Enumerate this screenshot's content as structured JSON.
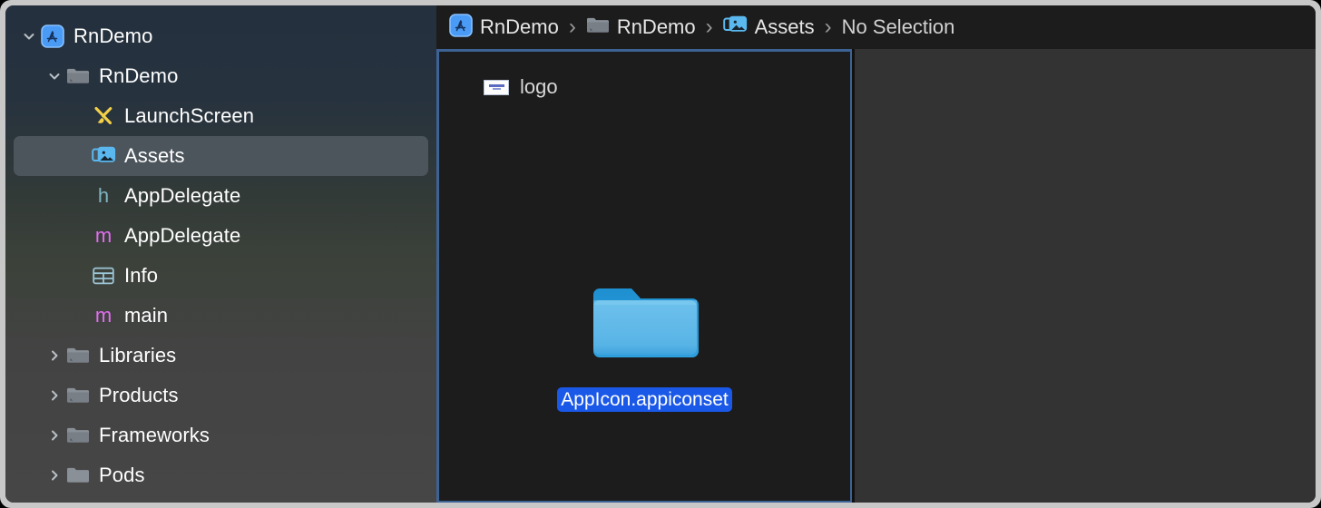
{
  "window": {
    "frame_color": "#c8c8c8",
    "background": "#1e1e1e"
  },
  "sidebar": {
    "name": "project-navigator",
    "background_top": "#24303d",
    "background_bottom": "#464646",
    "selected_color": "#4c555c",
    "items": [
      {
        "label": "RnDemo",
        "icon": "app-project-icon",
        "level": 0,
        "twisty": "chevron-down",
        "selected": false
      },
      {
        "label": "RnDemo",
        "icon": "folder-group-icon",
        "level": 1,
        "twisty": "chevron-down",
        "selected": false
      },
      {
        "label": "LaunchScreen",
        "icon": "interface-builder-icon",
        "level": 2,
        "twisty": "none",
        "selected": false
      },
      {
        "label": "Assets",
        "icon": "assets-catalog-icon",
        "level": 2,
        "twisty": "none",
        "selected": true
      },
      {
        "label": "AppDelegate",
        "icon": "header-file-icon",
        "level": 2,
        "twisty": "none",
        "selected": false
      },
      {
        "label": "AppDelegate",
        "icon": "objc-file-icon",
        "level": 2,
        "twisty": "none",
        "selected": false
      },
      {
        "label": "Info",
        "icon": "plist-file-icon",
        "level": 2,
        "twisty": "none",
        "selected": false
      },
      {
        "label": "main",
        "icon": "objc-file-icon",
        "level": 2,
        "twisty": "none",
        "selected": false
      },
      {
        "label": "Libraries",
        "icon": "folder-group-icon",
        "level": 1,
        "twisty": "chevron-right",
        "selected": false
      },
      {
        "label": "Products",
        "icon": "folder-group-icon",
        "level": 1,
        "twisty": "chevron-right",
        "selected": false
      },
      {
        "label": "Frameworks",
        "icon": "folder-group-icon",
        "level": 1,
        "twisty": "chevron-right",
        "selected": false
      },
      {
        "label": "Pods",
        "icon": "folder-plain-icon",
        "level": 1,
        "twisty": "chevron-right",
        "selected": false
      }
    ]
  },
  "breadcrumb": {
    "separator": "›",
    "crumbs": [
      {
        "label": "RnDemo",
        "icon": "app-project-icon"
      },
      {
        "label": "RnDemo",
        "icon": "folder-group-icon"
      },
      {
        "label": "Assets",
        "icon": "assets-catalog-icon"
      },
      {
        "label": "No Selection",
        "icon": "none"
      }
    ]
  },
  "asset_editor": {
    "focus_border_color": "#3d6395",
    "list": [
      {
        "label": "logo",
        "icon": "image-thumbnail",
        "selected": false
      }
    ],
    "grid": [
      {
        "label": "AppIcon.appiconset",
        "icon": "folder-blue-icon",
        "selected": true,
        "selection_color": "#1a58e8"
      }
    ],
    "detail_pane": {
      "label": "",
      "background": "#333333"
    }
  }
}
